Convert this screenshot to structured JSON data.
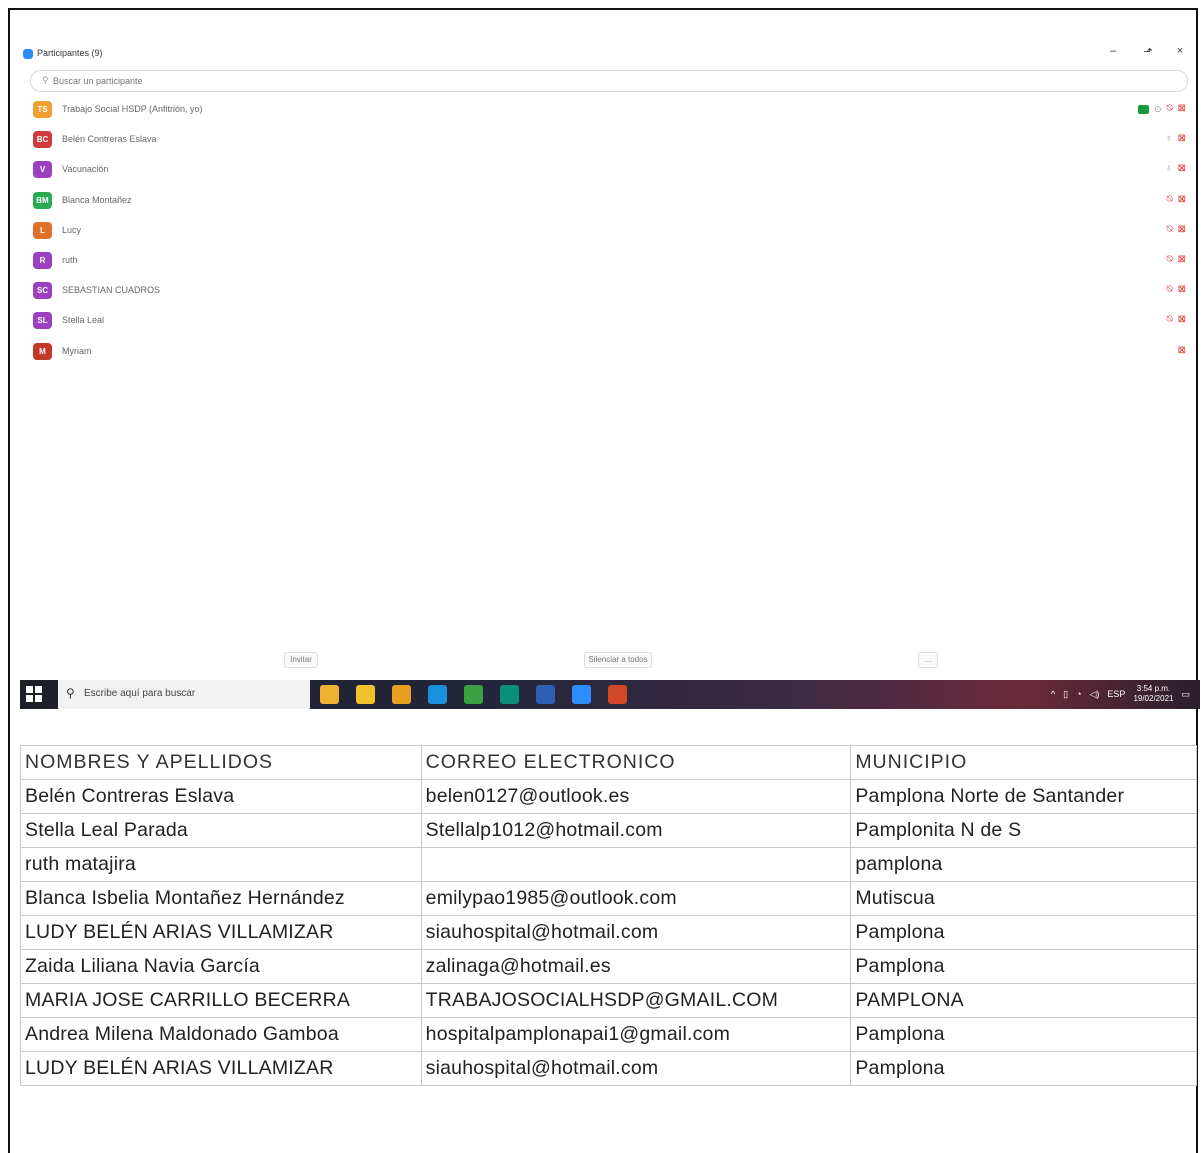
{
  "participants_panel": {
    "title": "Participantes (9)",
    "search_placeholder": "Buscar un participante",
    "window_controls": {
      "minimize": "–",
      "restore": "⬏",
      "close": "×"
    },
    "participants": [
      {
        "initials": "TS",
        "name": "Trabajo Social HSDP (Anfitrión, yo)",
        "color": "#f0a030",
        "share": true,
        "icons": [
          "share-icon",
          "hand-icon",
          "mic-muted-icon",
          "video-off-icon"
        ]
      },
      {
        "initials": "BC",
        "name": "Belén Contreras Eslava",
        "color": "#d03b3b",
        "icons": [
          "mic-icon",
          "video-off-icon"
        ]
      },
      {
        "initials": "V",
        "name": "Vacunación",
        "color": "#9b40c0",
        "icons": [
          "mic-icon",
          "video-off-icon"
        ]
      },
      {
        "initials": "BM",
        "name": "Blanca Montañez",
        "color": "#2aaa52",
        "icons": [
          "mic-muted-icon",
          "video-off-icon"
        ]
      },
      {
        "initials": "L",
        "name": "Lucy",
        "color": "#e0702a",
        "icons": [
          "mic-muted-icon",
          "video-off-icon"
        ]
      },
      {
        "initials": "R",
        "name": "ruth",
        "color": "#9b40c0",
        "icons": [
          "mic-muted-icon",
          "video-off-icon"
        ]
      },
      {
        "initials": "SC",
        "name": "SEBASTIAN CUADROS",
        "color": "#9b40c0",
        "icons": [
          "mic-muted-icon",
          "video-off-icon"
        ]
      },
      {
        "initials": "SL",
        "name": "Stella Leal",
        "color": "#9b40c0",
        "icons": [
          "mic-muted-icon",
          "video-off-icon"
        ]
      },
      {
        "initials": "M",
        "name": "Myriam",
        "color": "#c0392b",
        "icons": [
          "video-off-icon"
        ]
      }
    ],
    "footer": {
      "invite": "Invitar",
      "mute_all": "Silenciar a todos",
      "more": "..."
    }
  },
  "taskbar": {
    "search_text": "Escribe aquí para buscar",
    "apps": [
      {
        "name": "chart-app-icon",
        "color": "#f0b030"
      },
      {
        "name": "file-explorer-icon",
        "color": "#f2c12e"
      },
      {
        "name": "chrome-icon",
        "color": "#e8a020"
      },
      {
        "name": "edge-icon",
        "color": "#1a8fdc"
      },
      {
        "name": "app-icon",
        "color": "#3aa040"
      },
      {
        "name": "publisher-icon",
        "color": "#0b8f7a"
      },
      {
        "name": "word-icon",
        "color": "#2b5fb3"
      },
      {
        "name": "zoom-icon",
        "color": "#2d8cff"
      },
      {
        "name": "powerpoint-icon",
        "color": "#d24726"
      }
    ],
    "tray": {
      "lang": "ESP",
      "time": "3:54 p.m.",
      "date": "19/02/2021"
    }
  },
  "table": {
    "headers": [
      "NOMBRES Y APELLIDOS",
      "CORREO ELECTRONICO",
      "MUNICIPIO"
    ],
    "rows": [
      [
        "Belén Contreras Eslava",
        "belen0127@outlook.es",
        "Pamplona Norte de Santander"
      ],
      [
        "Stella Leal Parada",
        "Stellalp1012@hotmail.com",
        "Pamplonita N de S"
      ],
      [
        "ruth matajira",
        "",
        "pamplona"
      ],
      [
        "Blanca Isbelia Montañez Hernández",
        "emilypao1985@outlook.com",
        "Mutiscua"
      ],
      [
        "LUDY BELÉN ARIAS VILLAMIZAR",
        "siauhospital@hotmail.com",
        "Pamplona"
      ],
      [
        "Zaida Liliana Navia García",
        "zalinaga@hotmail.es",
        "Pamplona"
      ],
      [
        "MARIA JOSE CARRILLO BECERRA",
        "TRABAJOSOCIALHSDP@GMAIL.COM",
        "PAMPLONA"
      ],
      [
        "Andrea Milena Maldonado Gamboa",
        "hospitalpamplonapai1@gmail.com",
        "Pamplona"
      ],
      [
        "LUDY BELÉN ARIAS VILLAMIZAR",
        "siauhospital@hotmail.com",
        "Pamplona"
      ]
    ]
  }
}
